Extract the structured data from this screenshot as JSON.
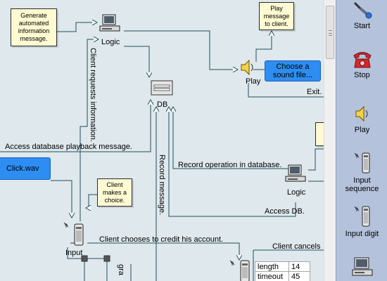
{
  "canvas": {
    "notes": {
      "generate": "Generate automated information message.",
      "play_message": "Play message to client.",
      "client_choice": "Client makes a choice."
    },
    "blue_boxes": {
      "choose_sound": "Choose a sound file...",
      "click_wav": "Click.wav"
    },
    "nodes": {
      "logic_top": "Logic",
      "db": "DB",
      "play": "Play",
      "logic_right": "Logic",
      "input": "Input"
    },
    "connections": {
      "client_requests": "Client requests information.",
      "exit": "Exit.",
      "access_db_playback": "Access database playback message.",
      "record_message": "Record message.",
      "record_operation": "Record operation in database.",
      "access_db": "Access DB.",
      "client_chooses_credit": "Client chooses to credit his account.",
      "client_cancels": "Client cancels",
      "partial_bottom": "gra"
    },
    "properties": [
      {
        "key": "length",
        "value": "14"
      },
      {
        "key": "timeout",
        "value": "45"
      }
    ]
  },
  "palette": {
    "items": [
      {
        "label": "Start",
        "icon": "start-icon"
      },
      {
        "label": "Stop",
        "icon": "stop-phone-icon"
      },
      {
        "label": "Play",
        "icon": "speaker-icon"
      },
      {
        "label": "Input sequence",
        "icon": "input-sequence-icon"
      },
      {
        "label": "Input digit",
        "icon": "input-digit-icon"
      },
      {
        "label": "",
        "icon": "computer-icon"
      }
    ]
  }
}
